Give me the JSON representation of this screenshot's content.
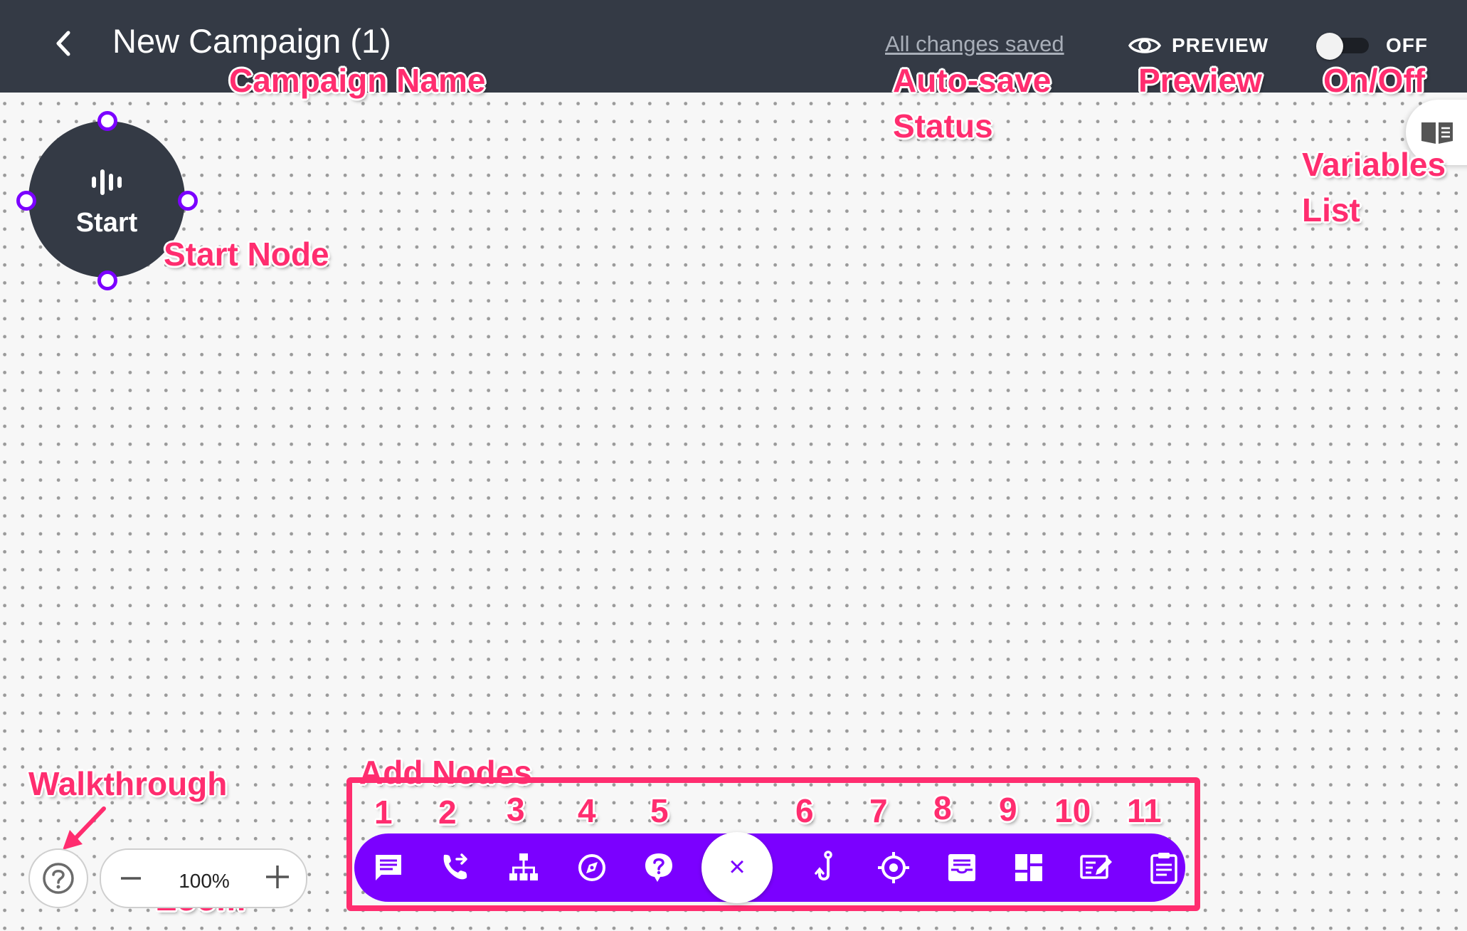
{
  "header": {
    "title": "New Campaign (1)",
    "autosave_status": "All changes saved",
    "preview_label": "PREVIEW",
    "toggle_state_label": "OFF",
    "toggle_on": false
  },
  "canvas": {
    "start_node_label": "Start"
  },
  "zoom": {
    "value": "100%",
    "minus": "−",
    "plus": "+"
  },
  "toolbar": {
    "close_symbol": "×",
    "tools": [
      {
        "number": "1",
        "icon": "message-icon"
      },
      {
        "number": "2",
        "icon": "phone-forward-icon"
      },
      {
        "number": "3",
        "icon": "sitemap-icon"
      },
      {
        "number": "4",
        "icon": "compass-icon"
      },
      {
        "number": "5",
        "icon": "question-bubble-icon"
      },
      {
        "number": "6",
        "icon": "hook-icon"
      },
      {
        "number": "7",
        "icon": "target-icon"
      },
      {
        "number": "8",
        "icon": "inbox-icon"
      },
      {
        "number": "9",
        "icon": "dashboard-icon"
      },
      {
        "number": "10",
        "icon": "edit-note-icon"
      },
      {
        "number": "11",
        "icon": "clipboard-icon"
      }
    ]
  },
  "annotations": {
    "campaign_name": "Campaign Name",
    "autosave_line1": "Auto-save",
    "autosave_line2": "Status",
    "preview": "Preview",
    "on_off": "On/Off",
    "variables_line1": "Variables",
    "variables_line2": "List",
    "start_node": "Start Node",
    "walkthrough": "Walkthrough",
    "zoom": "Zoom",
    "add_nodes": "Add Nodes"
  },
  "colors": {
    "header_bg": "#343a45",
    "accent_purple": "#7b00ff",
    "annotation_pink": "#ff2d6f"
  }
}
